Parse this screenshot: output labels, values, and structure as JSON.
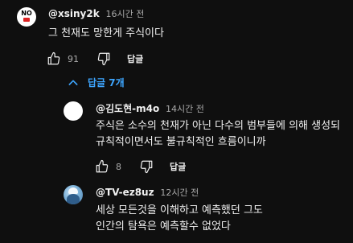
{
  "comment": {
    "author": "@xsiny2k",
    "time": "16시간 전",
    "text": "그 천재도 망한게 주식이다",
    "likes": "91",
    "reply_label": "답글"
  },
  "replies_toggle": {
    "label": "답글 7개",
    "accent": "#3ea6ff"
  },
  "replies": [
    {
      "author": "@김도현-m4o",
      "time": "14시간 전",
      "lines": [
        "주식은 소수의 천재가 아닌 다수의 범부들에 의해 생성되",
        "규칙적이면서도 불규칙적인 흐름이니까"
      ],
      "likes": "8",
      "reply_label": "답글"
    },
    {
      "author": "@TV-ez8uz",
      "time": "12시간 전",
      "lines": [
        "세상 모든것을 이해하고 예측했던 그도",
        "인간의 탐욕은 예측할수 없었다"
      ]
    }
  ],
  "icons": {
    "like": "thumbs-up-icon",
    "dislike": "thumbs-down-icon",
    "collapse": "chevron-up-icon"
  }
}
